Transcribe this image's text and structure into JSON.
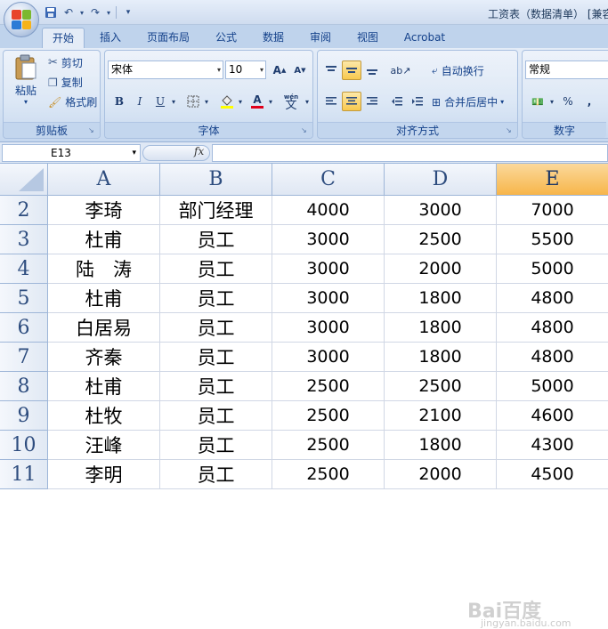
{
  "window": {
    "title": "工资表（数据清单）  [兼容"
  },
  "quick_access": {
    "icons": [
      "save-icon",
      "undo-icon",
      "redo-icon",
      "customize-icon"
    ]
  },
  "ribbon_tabs": [
    {
      "label": "开始",
      "active": true
    },
    {
      "label": "插入"
    },
    {
      "label": "页面布局"
    },
    {
      "label": "公式"
    },
    {
      "label": "数据"
    },
    {
      "label": "审阅"
    },
    {
      "label": "视图"
    },
    {
      "label": "Acrobat"
    }
  ],
  "clipboard": {
    "paste": "粘贴",
    "cut": "剪切",
    "copy": "复制",
    "format_painter": "格式刷",
    "group_label": "剪贴板"
  },
  "font_group": {
    "font_name": "宋体",
    "font_size": "10",
    "grow": "A",
    "shrink": "A",
    "bold": "B",
    "italic": "I",
    "underline": "U",
    "font_color": "A",
    "phonetic": "wén\n文",
    "group_label": "字体"
  },
  "alignment_group": {
    "wrap_text": "自动换行",
    "merge_center": "合并后居中",
    "group_label": "对齐方式"
  },
  "number_group": {
    "format": "常规",
    "percent": "%",
    "comma": ",",
    "group_label": "数字"
  },
  "formula_bar": {
    "name_box": "E13",
    "fx": "fx",
    "formula": ""
  },
  "sheet": {
    "columns": [
      "A",
      "B",
      "C",
      "D",
      "E"
    ],
    "selected_column": "E",
    "rows": [
      {
        "num": "2",
        "cells": [
          "李琦",
          "部门经理",
          "4000",
          "3000",
          "7000"
        ]
      },
      {
        "num": "3",
        "cells": [
          "杜甫",
          "员工",
          "3000",
          "2500",
          "5500"
        ]
      },
      {
        "num": "4",
        "cells": [
          "陆　涛",
          "员工",
          "3000",
          "2000",
          "5000"
        ]
      },
      {
        "num": "5",
        "cells": [
          "杜甫",
          "员工",
          "3000",
          "1800",
          "4800"
        ]
      },
      {
        "num": "6",
        "cells": [
          "白居易",
          "员工",
          "3000",
          "1800",
          "4800"
        ]
      },
      {
        "num": "7",
        "cells": [
          "齐秦",
          "员工",
          "3000",
          "1800",
          "4800"
        ]
      },
      {
        "num": "8",
        "cells": [
          "杜甫",
          "员工",
          "2500",
          "2500",
          "5000"
        ]
      },
      {
        "num": "9",
        "cells": [
          "杜牧",
          "员工",
          "2500",
          "2100",
          "4600"
        ]
      },
      {
        "num": "10",
        "cells": [
          "汪峰",
          "员工",
          "2500",
          "1800",
          "4300"
        ]
      },
      {
        "num": "11",
        "cells": [
          "李明",
          "员工",
          "2500",
          "2000",
          "4500"
        ]
      }
    ]
  },
  "watermark": {
    "text": "Bai百度",
    "sub": "jingyan.baidu.com"
  }
}
